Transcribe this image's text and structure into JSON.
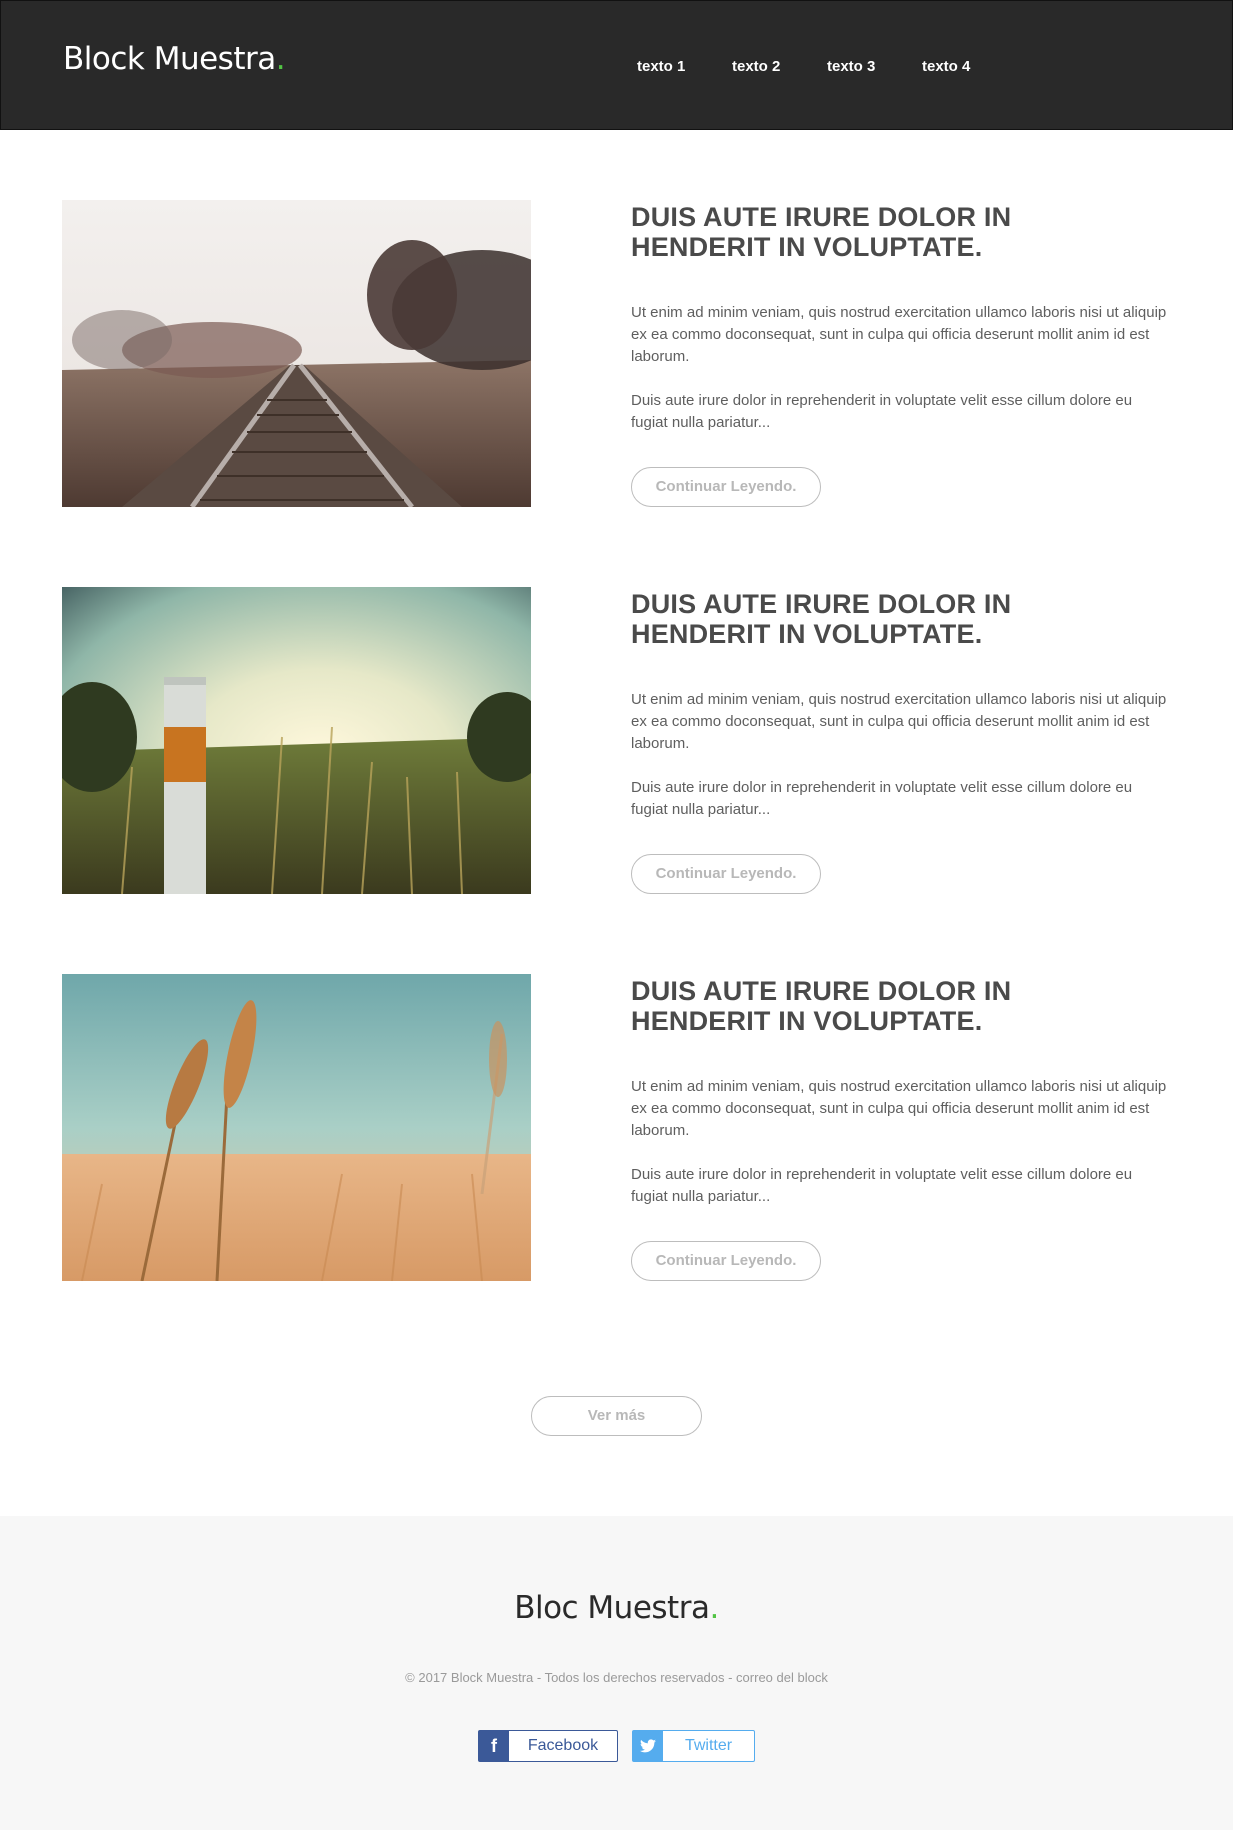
{
  "header": {
    "logo_text": "Block Muestra",
    "logo_dot": ".",
    "nav": [
      "texto 1",
      "texto 2",
      "texto 3",
      "texto 4"
    ]
  },
  "posts": [
    {
      "image": "railway-tracks-photo",
      "title": "DUIS AUTE IRURE DOLOR IN HENDERIT IN VOLUPTATE.",
      "p1": "Ut enim ad minim veniam, quis nostrud exercitation ullamco laboris nisi ut aliquip ex ea commo doconsequat, sunt in culpa qui officia deserunt mollit anim id est laborum.",
      "p2": "Duis aute irure dolor in reprehenderit in voluptate velit esse cillum dolore eu fugiat nulla pariatur...",
      "button": "Continuar Leyendo."
    },
    {
      "image": "sunset-grass-post-photo",
      "title": "DUIS AUTE IRURE DOLOR IN HENDERIT IN VOLUPTATE.",
      "p1": "Ut enim ad minim veniam, quis nostrud exercitation ullamco laboris nisi ut aliquip ex ea commo doconsequat, sunt in culpa qui officia deserunt mollit anim id est laborum.",
      "p2": "Duis aute irure dolor in reprehenderit in voluptate velit esse cillum dolore eu fugiat nulla pariatur...",
      "button": "Continuar Leyendo."
    },
    {
      "image": "wheat-field-photo",
      "title": "DUIS AUTE IRURE DOLOR IN HENDERIT IN VOLUPTATE.",
      "p1": "Ut enim ad minim veniam, quis nostrud exercitation ullamco laboris nisi ut aliquip ex ea commo doconsequat, sunt in culpa qui officia deserunt mollit anim id est laborum.",
      "p2": "Duis aute irure dolor in reprehenderit in voluptate velit esse cillum dolore eu fugiat nulla pariatur...",
      "button": "Continuar Leyendo."
    }
  ],
  "more_button": "Ver más",
  "footer": {
    "logo_text": "Bloc Muestra",
    "logo_dot": ".",
    "copyright": "© 2017 Block Muestra - Todos los derechos reservados - correo del block",
    "facebook": {
      "icon": "f",
      "label": "Facebook"
    },
    "twitter": {
      "icon": "twitter-bird",
      "label": "Twitter"
    }
  },
  "colors": {
    "header_bg": "#292929",
    "accent_dot": "#52c444",
    "facebook": "#3b5998",
    "twitter": "#55acee"
  }
}
